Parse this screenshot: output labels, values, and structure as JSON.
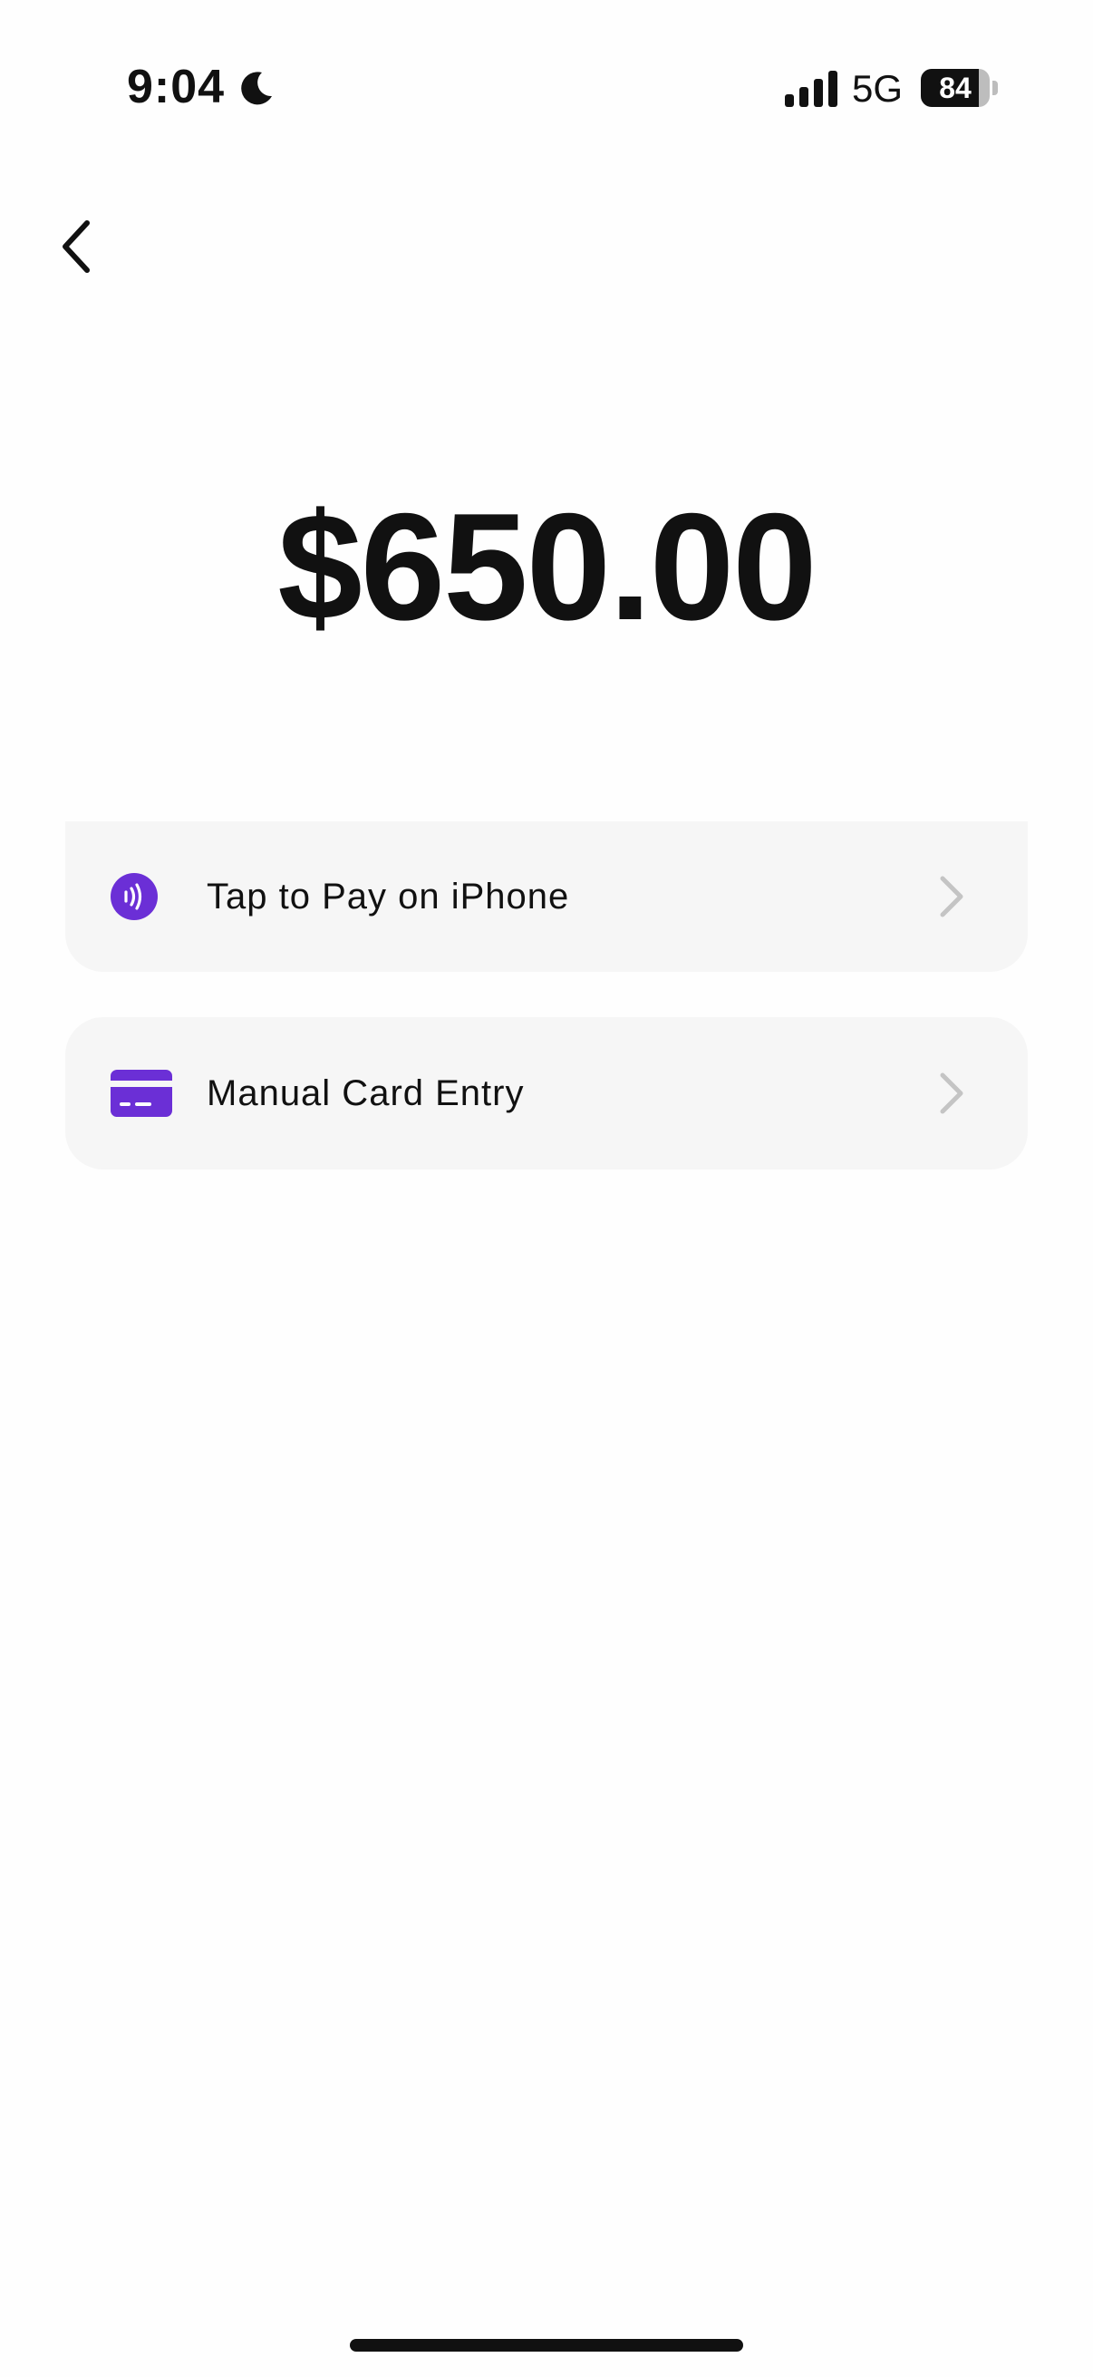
{
  "status_bar": {
    "time": "9:04",
    "network": "5G",
    "battery_level": "84",
    "battery_fraction": 0.84,
    "icons": [
      "moon-icon",
      "signal-icon",
      "battery-icon"
    ]
  },
  "navigation": {
    "back_icon": "chevron-left-icon"
  },
  "payment": {
    "amount": "$650.00"
  },
  "options": [
    {
      "label": "Tap to Pay on iPhone",
      "icon": "contactless-icon"
    },
    {
      "label": "Manual Card Entry",
      "icon": "credit-card-icon"
    }
  ],
  "colors": {
    "accent": "#6b2fd6",
    "row_background": "#f6f6f6",
    "chevron": "#c4c4c4",
    "text": "#111111"
  }
}
